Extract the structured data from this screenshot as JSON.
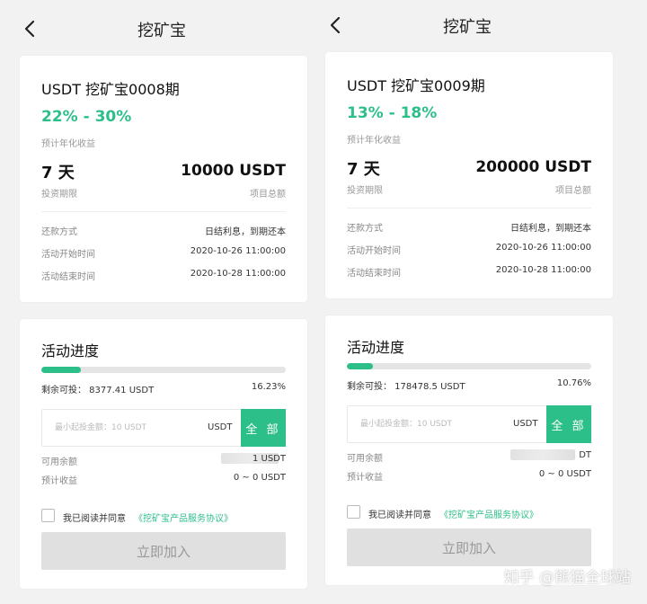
{
  "panels": [
    {
      "title": "挖矿宝",
      "product": {
        "name": "USDT 挖矿宝0008期",
        "rate": "22% - 30%",
        "rate_label": "预计年化收益",
        "days": "7 天",
        "days_label": "投资期限",
        "total": "10000 USDT",
        "total_label": "项目总额",
        "rows": [
          {
            "label": "还款方式",
            "value": "日结利息，到期还本"
          },
          {
            "label": "活动开始时间",
            "value": "2020-10-26 11:00:00"
          },
          {
            "label": "活动结束时间",
            "value": "2020-10-28 11:00:00"
          }
        ]
      },
      "progress": {
        "title": "活动进度",
        "fraction": 0.1623,
        "remaining": "剩余可投：  8377.41 USDT",
        "percent": "16.23%",
        "input_placeholder": "最小起投金额：10 USDT",
        "unit": "USDT",
        "all_label": "全 部",
        "balance_label": "可用余额",
        "balance_value": "1 USDT",
        "income_label": "预计收益",
        "income_value": "0 ~ 0 USDT",
        "agree_text": "我已阅读并同意",
        "agree_link": "《挖矿宝产品服务协议》",
        "join_label": "立即加入"
      }
    },
    {
      "title": "挖矿宝",
      "product": {
        "name": "USDT 挖矿宝0009期",
        "rate": "13% - 18%",
        "rate_label": "预计年化收益",
        "days": "7 天",
        "days_label": "投资期限",
        "total": "200000 USDT",
        "total_label": "项目总额",
        "rows": [
          {
            "label": "还款方式",
            "value": "日结利息，到期还本"
          },
          {
            "label": "活动开始时间",
            "value": "2020-10-26 11:00:00"
          },
          {
            "label": "活动结束时间",
            "value": "2020-10-28 11:00:00"
          }
        ]
      },
      "progress": {
        "title": "活动进度",
        "fraction": 0.1076,
        "remaining": "剩余可投：  178478.5 USDT",
        "percent": "10.76%",
        "input_placeholder": "最小起投金额：10 USDT",
        "unit": "USDT",
        "all_label": "全 部",
        "balance_label": "可用余额",
        "balance_value": "DT",
        "income_label": "预计收益",
        "income_value": "0 ~ 0 USDT",
        "agree_text": "我已阅读并同意",
        "agree_link": "《挖矿宝产品服务协议》",
        "join_label": "立即加入"
      }
    }
  ],
  "watermark": "知乎 @熊猫全球站",
  "colors": {
    "accent": "#2dbf8a",
    "disabled": "#e0e0e0",
    "background": "#f2f2f2"
  }
}
